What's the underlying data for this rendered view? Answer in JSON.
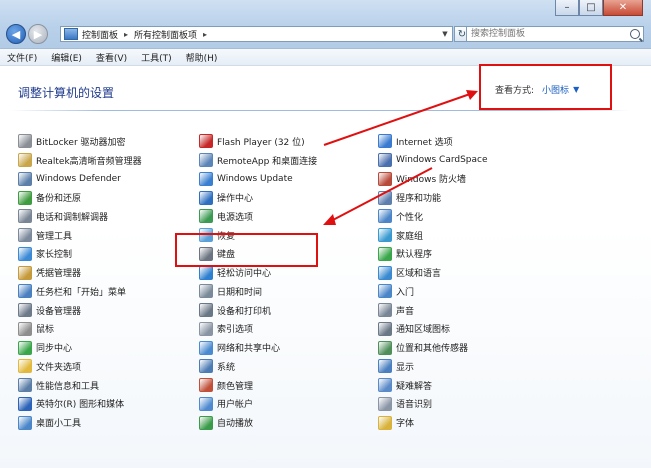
{
  "address": {
    "crumbs": [
      "控制面板",
      "所有控制面板项"
    ],
    "sep": "▸"
  },
  "search": {
    "placeholder": "搜索控制面板"
  },
  "menu": [
    "文件(F)",
    "编辑(E)",
    "查看(V)",
    "工具(T)",
    "帮助(H)"
  ],
  "header": {
    "title": "调整计算机的设置",
    "view_label": "查看方式:",
    "view_value": "小图标"
  },
  "col1": [
    {
      "label": "BitLocker 驱动器加密",
      "color": "#8a8f96"
    },
    {
      "label": "Realtek高清晰音频管理器",
      "color": "#c9a64a"
    },
    {
      "label": "Windows Defender",
      "color": "#5b7fa8"
    },
    {
      "label": "备份和还原",
      "color": "#3f9c3f"
    },
    {
      "label": "电话和调制解调器",
      "color": "#7a8696"
    },
    {
      "label": "管理工具",
      "color": "#7d8a9c"
    },
    {
      "label": "家长控制",
      "color": "#3c8ad6"
    },
    {
      "label": "凭据管理器",
      "color": "#c59a3a"
    },
    {
      "label": "任务栏和「开始」菜单",
      "color": "#4a7fc0"
    },
    {
      "label": "设备管理器",
      "color": "#6d7a8a"
    },
    {
      "label": "鼠标",
      "color": "#8e8e8e"
    },
    {
      "label": "同步中心",
      "color": "#3aa64a"
    },
    {
      "label": "文件夹选项",
      "color": "#e2b93c"
    },
    {
      "label": "性能信息和工具",
      "color": "#5a7ea6"
    },
    {
      "label": "英特尔(R) 图形和媒体",
      "color": "#2c63b8"
    },
    {
      "label": "桌面小工具",
      "color": "#4a86c8"
    }
  ],
  "col2": [
    {
      "label": "Flash Player (32 位)",
      "color": "#c62828"
    },
    {
      "label": "RemoteApp 和桌面连接",
      "color": "#5b84b8"
    },
    {
      "label": "Windows Update",
      "color": "#3a7fd0"
    },
    {
      "label": "操作中心",
      "color": "#2e6fc0"
    },
    {
      "label": "电源选项",
      "color": "#3c9a52"
    },
    {
      "label": "恢复",
      "color": "#5aa0d8"
    },
    {
      "label": "键盘",
      "color": "#6b7480"
    },
    {
      "label": "轻松访问中心",
      "color": "#2d7fd0"
    },
    {
      "label": "日期和时间",
      "color": "#7b8a9a"
    },
    {
      "label": "设备和打印机",
      "color": "#6a7786"
    },
    {
      "label": "索引选项",
      "color": "#8a95a3"
    },
    {
      "label": "网络和共享中心",
      "color": "#4a8ad0"
    },
    {
      "label": "系统",
      "color": "#4d7cb5"
    },
    {
      "label": "颜色管理",
      "color": "#c0503a"
    },
    {
      "label": "用户帐户",
      "color": "#4f8ad0"
    },
    {
      "label": "自动播放",
      "color": "#3b9b4a"
    }
  ],
  "col3": [
    {
      "label": "Internet 选项",
      "color": "#3a7bd0"
    },
    {
      "label": "Windows CardSpace",
      "color": "#4a6fae"
    },
    {
      "label": "Windows 防火墙",
      "color": "#b84a3a"
    },
    {
      "label": "程序和功能",
      "color": "#5c7fae"
    },
    {
      "label": "个性化",
      "color": "#4c86c8"
    },
    {
      "label": "家庭组",
      "color": "#3a9ad0"
    },
    {
      "label": "默认程序",
      "color": "#3aa64a"
    },
    {
      "label": "区域和语言",
      "color": "#3b8ad0"
    },
    {
      "label": "入门",
      "color": "#4a86c8"
    },
    {
      "label": "声音",
      "color": "#7a8696"
    },
    {
      "label": "通知区域图标",
      "color": "#6b7886"
    },
    {
      "label": "位置和其他传感器",
      "color": "#4f8f5a"
    },
    {
      "label": "显示",
      "color": "#4a7fc0"
    },
    {
      "label": "疑难解答",
      "color": "#5a8ac8"
    },
    {
      "label": "语音识别",
      "color": "#8a96a6"
    },
    {
      "label": "字体",
      "color": "#d8b23a"
    }
  ]
}
